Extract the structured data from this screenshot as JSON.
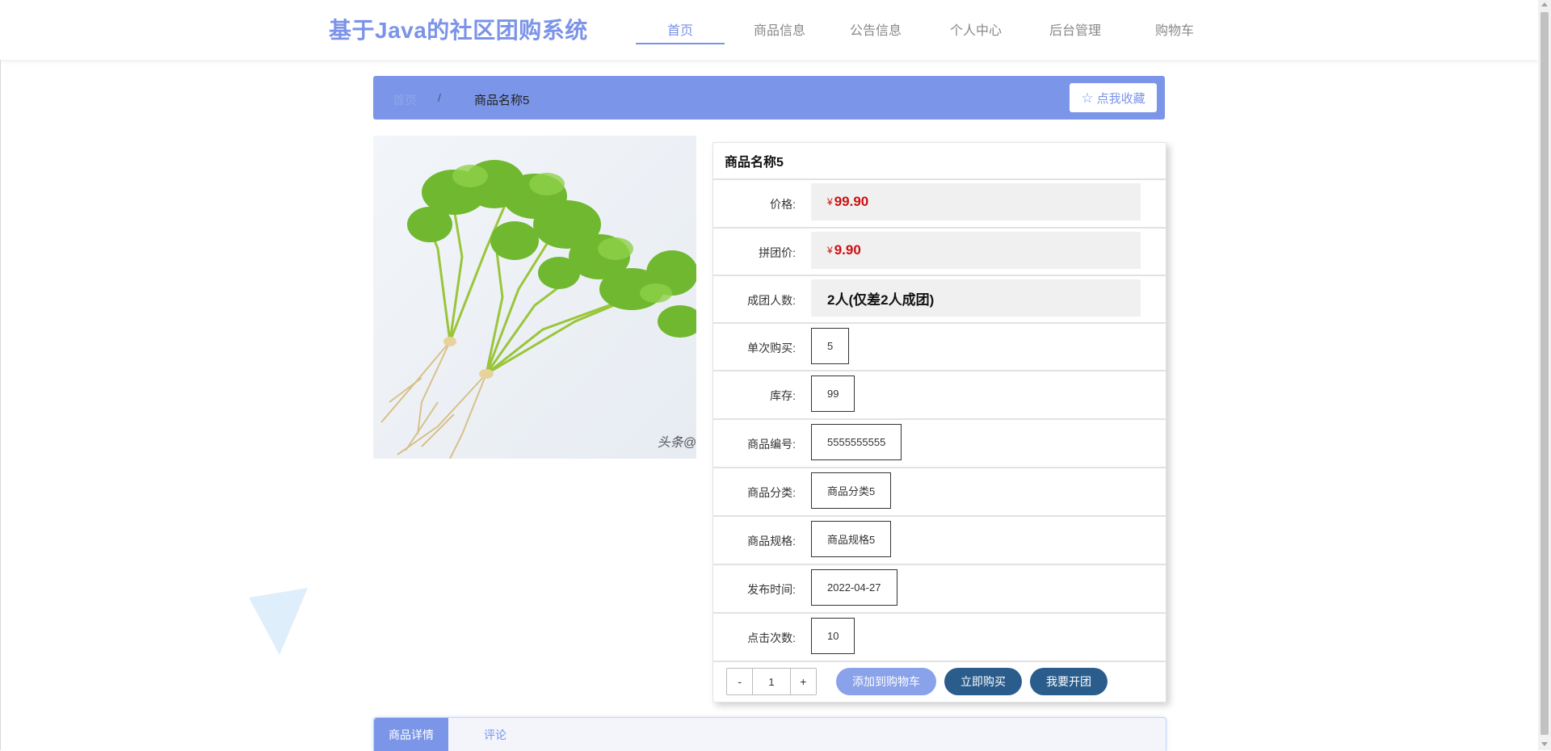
{
  "header": {
    "site_title": "基于Java的社区团购系统",
    "nav": [
      {
        "label": "首页",
        "active": true
      },
      {
        "label": "商品信息"
      },
      {
        "label": "公告信息"
      },
      {
        "label": "个人中心"
      },
      {
        "label": "后台管理"
      },
      {
        "label": "购物车"
      }
    ]
  },
  "breadcrumb": {
    "home": "首页",
    "separator": "/",
    "current": "商品名称5",
    "favorite_label": "点我收藏"
  },
  "product": {
    "image_watermark": "头条@",
    "title": "商品名称5",
    "currency": "¥",
    "rows": {
      "price": {
        "label": "价格:",
        "value": "99.90"
      },
      "group_price": {
        "label": "拼团价:",
        "value": "9.90"
      },
      "group_size": {
        "label": "成团人数:",
        "value": "2人(仅差2人成团)"
      },
      "per_purchase": {
        "label": "单次购买:",
        "value": "5"
      },
      "stock": {
        "label": "库存:",
        "value": "99"
      },
      "code": {
        "label": "商品编号:",
        "value": "5555555555"
      },
      "category": {
        "label": "商品分类:",
        "value": "商品分类5"
      },
      "spec": {
        "label": "商品规格:",
        "value": "商品规格5"
      },
      "publish_time": {
        "label": "发布时间:",
        "value": "2022-04-27"
      },
      "clicks": {
        "label": "点击次数:",
        "value": "10"
      }
    },
    "quantity": {
      "minus": "-",
      "value": "1",
      "plus": "+"
    },
    "actions": {
      "add_to_cart": "添加到购物车",
      "buy_now": "立即购买",
      "start_group": "我要开团"
    }
  },
  "tabs": [
    {
      "label": "商品详情",
      "active": true
    },
    {
      "label": "评论"
    }
  ],
  "colors": {
    "accent": "#7b93e8",
    "price_red": "#cc1010",
    "dark_button": "#2a5d8c"
  }
}
